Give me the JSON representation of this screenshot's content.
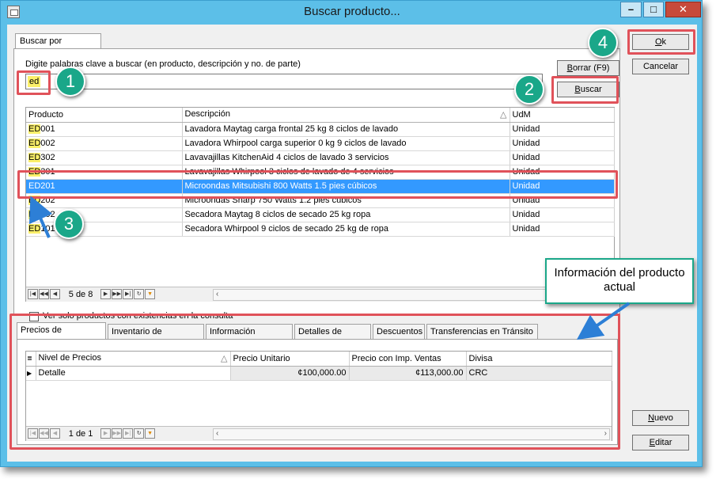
{
  "window": {
    "title": "Buscar producto...",
    "minimize": "–",
    "maximize": "□",
    "close": "✕"
  },
  "main_tab": "Buscar por Consulta",
  "search": {
    "label": "Digite palabras clave a buscar (en producto, descripción y no. de parte)",
    "value": "ed",
    "clear_button": "Borrar (F9)",
    "search_button": "Buscar"
  },
  "dialog_buttons": {
    "ok": "Ok",
    "cancel": "Cancelar",
    "new": "Nuevo",
    "edit": "Editar"
  },
  "products": {
    "columns": [
      "Producto",
      "Descripción",
      "UdM"
    ],
    "rows": [
      {
        "code_hl": "ED",
        "code_rest": "001",
        "description": "Lavadora Maytag carga frontal 25 kg 8 ciclos de lavado",
        "uom": "Unidad"
      },
      {
        "code_hl": "ED",
        "code_rest": "002",
        "description": "Lavadora Whirpool carga superior 0 kg 9 ciclos de lavado",
        "uom": "Unidad"
      },
      {
        "code_hl": "ED",
        "code_rest": "302",
        "description": "Lavavajillas KitchenAid 4 ciclos de lavado 3 servicios",
        "uom": "Unidad"
      },
      {
        "code_hl": "ED",
        "code_rest": "301",
        "description": "Lavavajillas Whirpool 3 ciclos de lavado de 4 servicios",
        "uom": "Unidad"
      },
      {
        "code_hl": "ED",
        "code_rest": "201",
        "description": "Microondas Mitsubishi 800 Watts 1.5 pies cúbicos",
        "uom": "Unidad"
      },
      {
        "code_hl": "ED",
        "code_rest": "202",
        "description": "Microondas Sharp 750 Watts 1.2 pies cúbicos",
        "uom": "Unidad"
      },
      {
        "code_hl": "ED",
        "code_rest": "102",
        "description": "Secadora Maytag 8 ciclos de secado 25 kg ropa",
        "uom": "Unidad"
      },
      {
        "code_hl": "ED",
        "code_rest": "101",
        "description": "Secadora Whirpool 9 ciclos de secado 25  kg de ropa",
        "uom": "Unidad"
      }
    ],
    "selected_index": 4,
    "pager": "5 de 8"
  },
  "stock_only_checkbox": "Ver solo productos con existencias en la consulta",
  "detail_tabs": [
    "Precios de Productos",
    "Inventario de Productos",
    "Información Adicional",
    "Detalles de Partes",
    "Descuentos",
    "Transferencias en Tránsito"
  ],
  "prices": {
    "columns": [
      "Nivel de Precios",
      "Precio Unitario",
      "Precio con Imp. Ventas",
      "Divisa"
    ],
    "rows": [
      {
        "level": "Detalle",
        "unit_price": "¢100,000.00",
        "price_tax": "¢113,000.00",
        "currency": "CRC"
      }
    ],
    "pager": "1 de 1"
  },
  "annotations": {
    "callouts": [
      "1",
      "2",
      "3",
      "4"
    ],
    "info_box": "Información del producto actual"
  },
  "colors": {
    "accent": "#1aa789",
    "highlight": "#3399ff",
    "annotation_red": "#e0525a",
    "titlebar": "#5cbfe8"
  }
}
